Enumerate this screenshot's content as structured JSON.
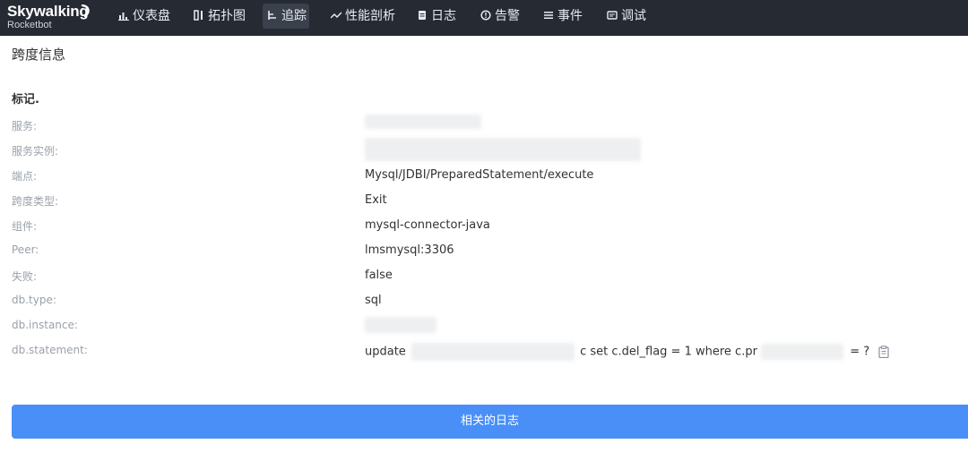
{
  "app": {
    "logo_main": "Skywalking",
    "logo_sub": "Rocketbot"
  },
  "nav": {
    "items": [
      {
        "label": "仪表盘",
        "icon": "dashboard-icon",
        "active": false
      },
      {
        "label": "拓扑图",
        "icon": "topology-icon",
        "active": false
      },
      {
        "label": "追踪",
        "icon": "trace-icon",
        "active": true
      },
      {
        "label": "性能剖析",
        "icon": "profile-icon",
        "active": false
      },
      {
        "label": "日志",
        "icon": "log-icon",
        "active": false
      },
      {
        "label": "告警",
        "icon": "alarm-icon",
        "active": false
      },
      {
        "label": "事件",
        "icon": "event-icon",
        "active": false
      },
      {
        "label": "调试",
        "icon": "debug-icon",
        "active": false
      }
    ]
  },
  "page": {
    "title": "跨度信息",
    "section_title": "标记."
  },
  "tags": [
    {
      "key": "服务:",
      "value": ""
    },
    {
      "key": "服务实例:",
      "value": ""
    },
    {
      "key": "端点:",
      "value": "Mysql/JDBI/PreparedStatement/execute"
    },
    {
      "key": "跨度类型:",
      "value": "Exit"
    },
    {
      "key": "组件:",
      "value": "mysql-connector-java"
    },
    {
      "key": "Peer:",
      "value": "lmsmysql:3306"
    },
    {
      "key": "失败:",
      "value": "false"
    },
    {
      "key": "db.type:",
      "value": "sql"
    },
    {
      "key": "db.instance:",
      "value": ""
    },
    {
      "key": "db.statement:",
      "value": ""
    }
  ],
  "statement": {
    "part1": "update",
    "part2": "c set c.del_flag = 1 where c.pr",
    "part3": "= ?"
  },
  "actions": {
    "related_logs_label": "相关的日志"
  },
  "colors": {
    "navbar_bg": "#252a33",
    "accent": "#4a8ff7"
  }
}
